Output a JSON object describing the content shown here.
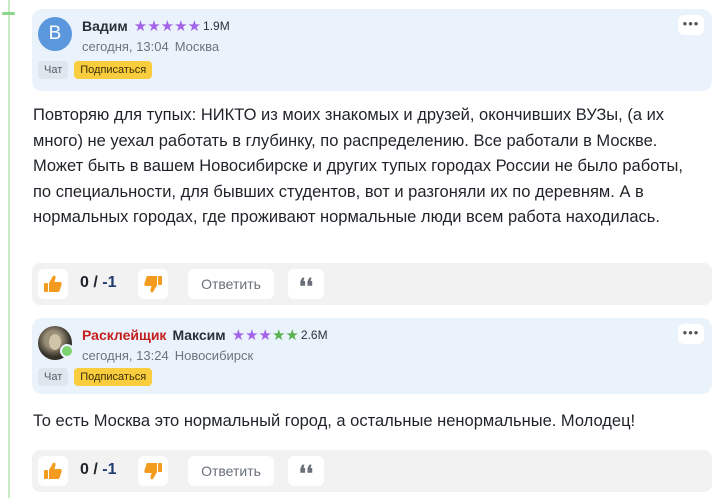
{
  "comments": [
    {
      "author": {
        "first": "Вадим",
        "last": "",
        "avatar_letter": "В"
      },
      "rating": "1.9M",
      "date": "сегодня, 13:04",
      "city": "Москва",
      "chat_label": "Чат",
      "subscribe_label": "Подписаться",
      "more_label": "•••",
      "text": "Повторяю для тупых: НИКТО из моих знакомых и друзей, окончивших ВУЗы, (а их много) не уехал работать в глубинку, по распределению. Все работали в Москве. Может быть в вашем Новосибирске и других тупых городах России не было работы, по специальности, для бывших студентов, вот и разгоняли их по деревням. А в нормальных городах, где проживают нормальные люди всем работа находилась.",
      "score_pos": "0",
      "score_sep": " / ",
      "score_neg": "-1",
      "reply_label": "Ответить",
      "quote_label": "❛❛"
    },
    {
      "author": {
        "first": "Расклейщик",
        "last": "Максим"
      },
      "rating": "2.6M",
      "date": "сегодня, 13:24",
      "city": "Новосибирск",
      "chat_label": "Чат",
      "subscribe_label": "Подписаться",
      "more_label": "•••",
      "text": "То есть Москва это нормальный город, а остальные ненормальные. Молодец!",
      "score_pos": "0",
      "score_sep": " / ",
      "score_neg": "-1",
      "reply_label": "Ответить",
      "quote_label": "❛❛"
    }
  ],
  "icons": {
    "like": "thumbs-up-icon",
    "dislike": "thumbs-down-icon",
    "star": "star-icon"
  },
  "colors": {
    "header_bg": "#eaf3fc",
    "subscribe_bg": "#f9cd3e",
    "vote_orange": "#f29b1e",
    "star_purple": "#a463e8",
    "star_green": "#58b24d",
    "author_red": "#c41e1e"
  }
}
